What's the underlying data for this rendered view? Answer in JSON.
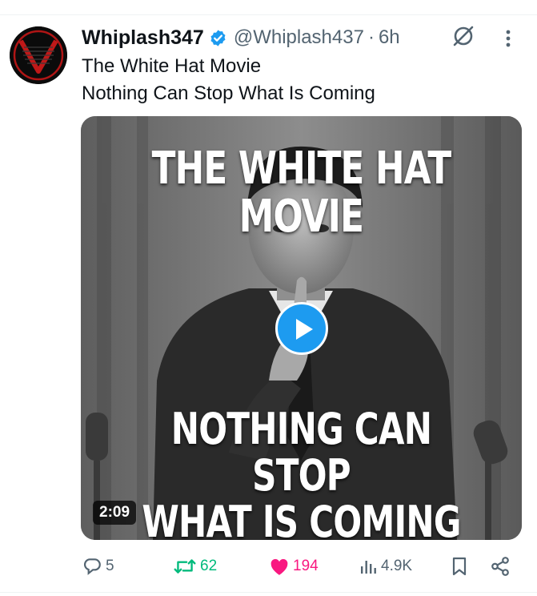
{
  "author": {
    "display_name": "Whiplash347",
    "handle": "@Whiplash437",
    "separator": "·",
    "time": "6h",
    "verified": true
  },
  "tweet": {
    "lines": [
      "The White Hat Movie",
      "Nothing Can Stop What Is Coming"
    ]
  },
  "media": {
    "caption_top": "THE WHITE HAT MOVIE",
    "caption_bottom_line1": "NOTHING CAN STOP",
    "caption_bottom_line2": "WHAT IS COMING",
    "duration": "2:09"
  },
  "actions": {
    "replies": "5",
    "retweets": "62",
    "likes": "194",
    "views": "4.9K"
  },
  "colors": {
    "accent": "#1d9bf0",
    "retweet": "#00ba7c",
    "like": "#f91880",
    "muted": "#536471"
  },
  "icons": [
    "verified-badge-icon",
    "grok-icon",
    "more-icon",
    "play-icon",
    "reply-icon",
    "retweet-icon",
    "like-icon",
    "views-icon",
    "bookmark-icon",
    "share-icon"
  ]
}
